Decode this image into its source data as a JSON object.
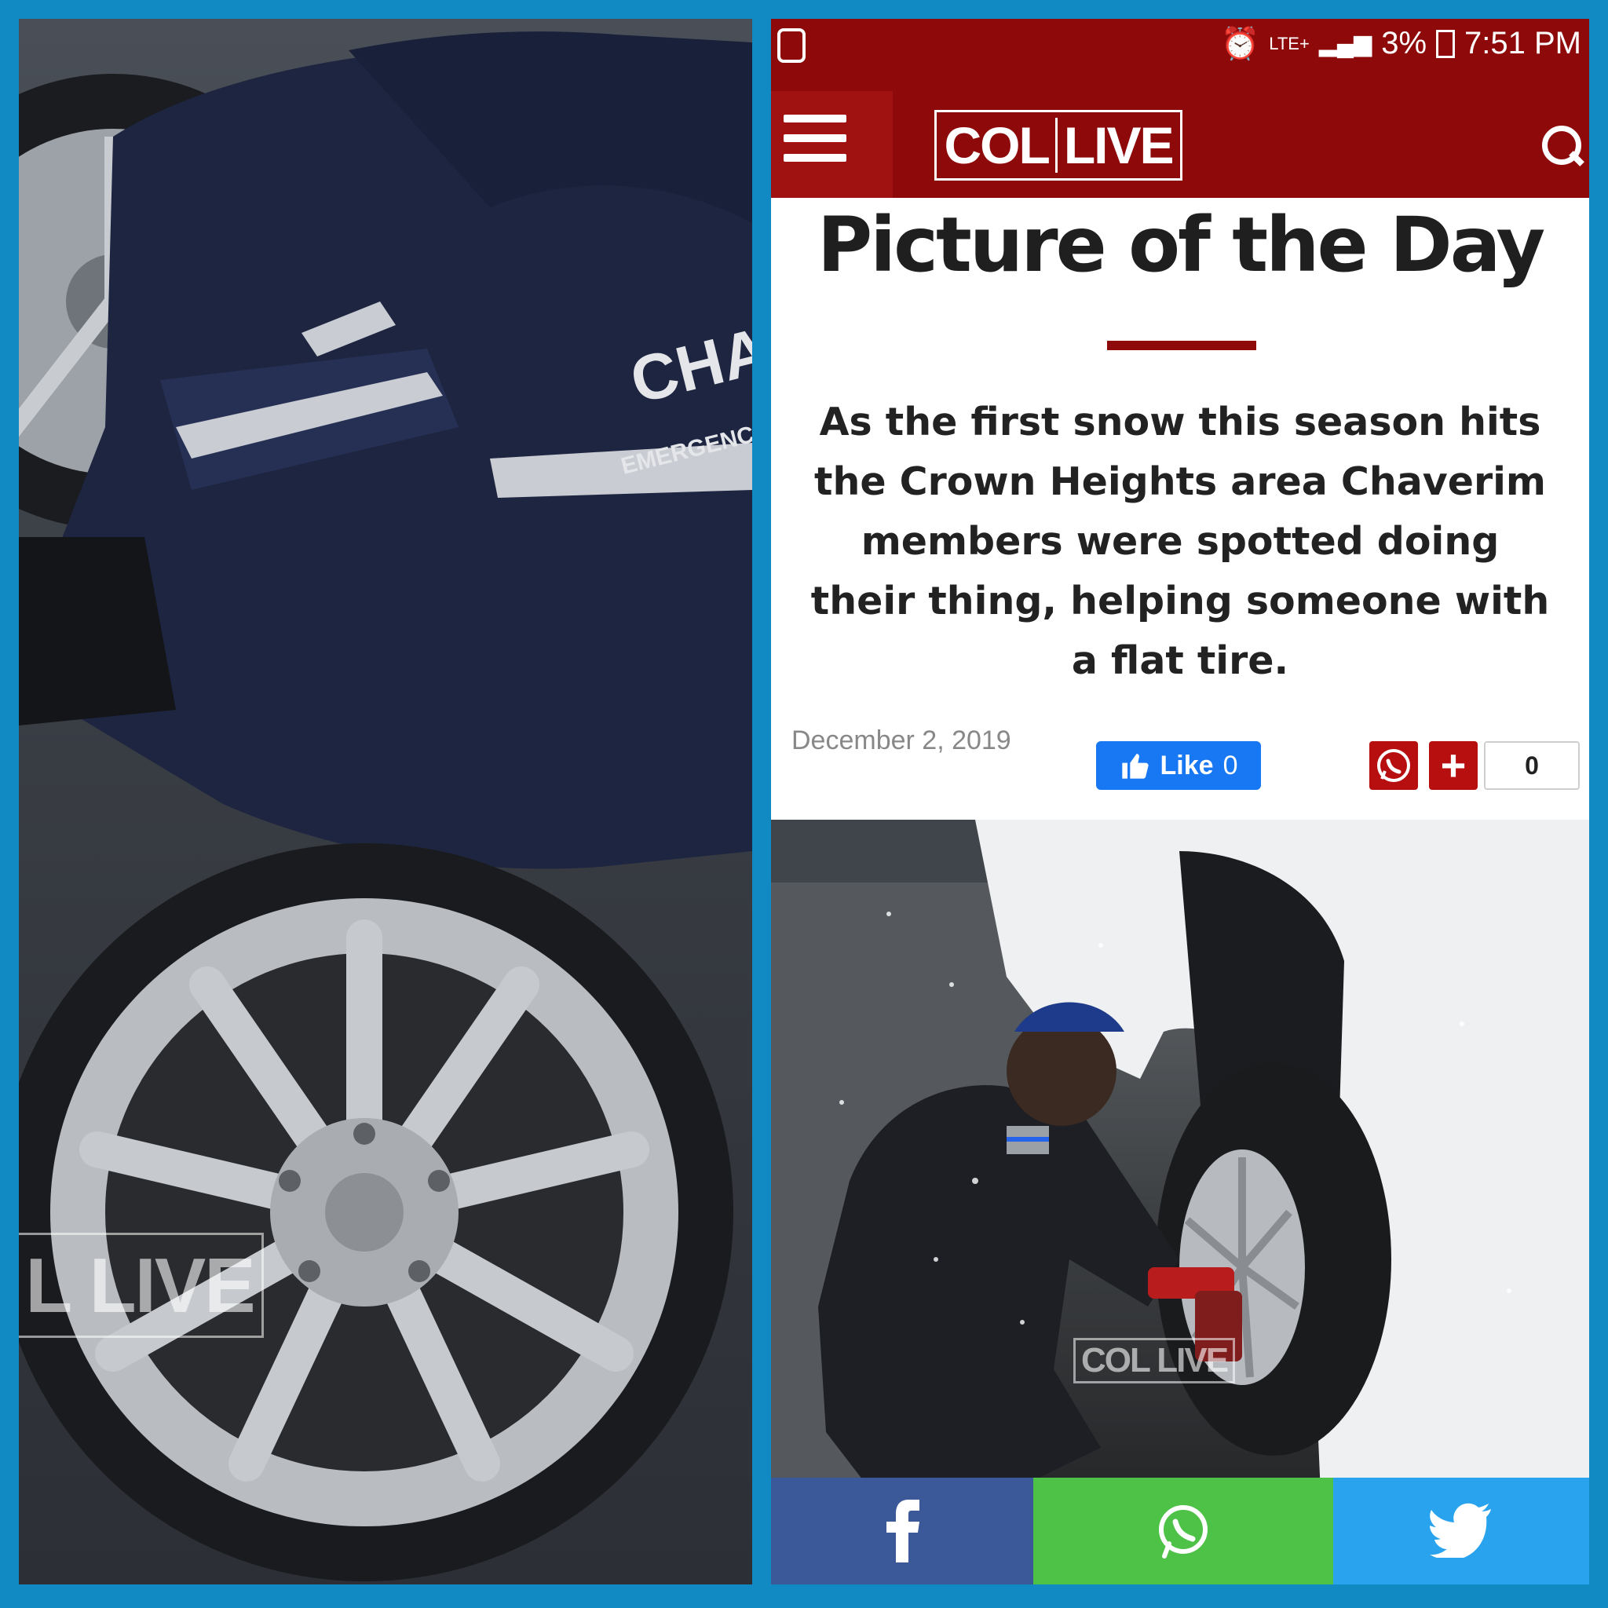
{
  "left_photo": {
    "jacket_text_1": "CHAV",
    "jacket_text_2": "EMERGENCY",
    "watermark": "L LIVE"
  },
  "status_bar": {
    "network": "LTE+",
    "battery": "3%",
    "time": "7:51 PM"
  },
  "header": {
    "logo_part1": "COL",
    "logo_part2": "LIVE"
  },
  "article": {
    "title": "Picture of the Day",
    "summary": "As the first snow this season hits the Crown Heights area Chaverim members were spotted doing their thing, helping someone with a flat tire.",
    "date": "December 2, 2019",
    "like_label": "Like",
    "like_count": "0",
    "share_count": "0",
    "plus_label": "+"
  },
  "article_photo": {
    "watermark": "COL LIVE"
  },
  "colors": {
    "brand": "#8e0a0a",
    "facebook": "#3b5998",
    "whatsapp": "#4dc247",
    "twitter": "#2aa3ef",
    "frame": "#118ac4"
  },
  "icons": [
    "menu-icon",
    "search-icon",
    "thumbs-up-icon",
    "whatsapp-icon",
    "plus-icon",
    "facebook-icon",
    "twitter-icon"
  ]
}
